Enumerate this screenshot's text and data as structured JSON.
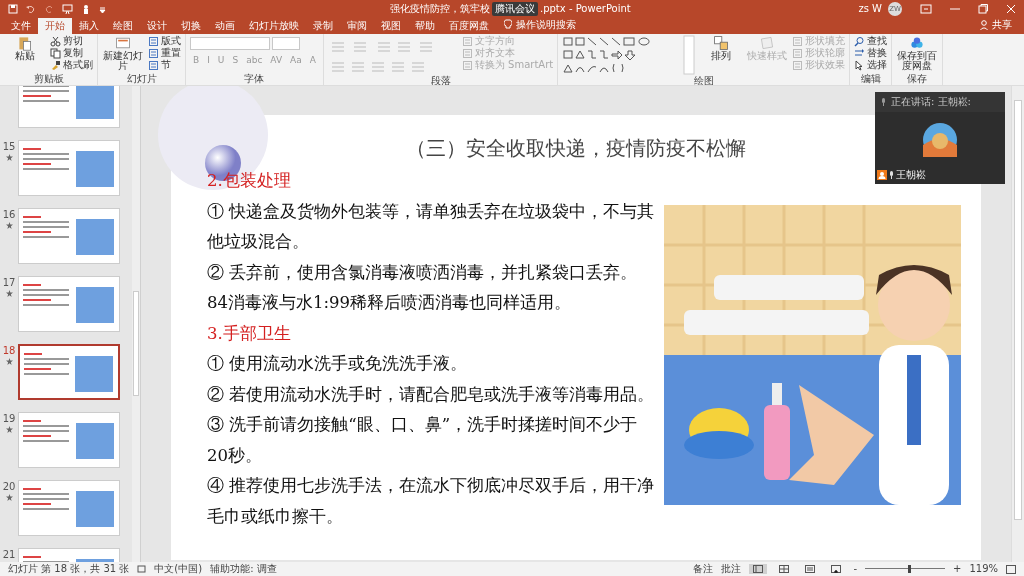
{
  "window": {
    "title": "强化疫情防控，筑牢校",
    "title_suffix": ".pptx  -  PowerPoint",
    "user": "zs W",
    "avatar": "ZW"
  },
  "meeting_badge": "腾讯会议",
  "tabs": [
    {
      "label": "文件",
      "selected": false
    },
    {
      "label": "开始",
      "selected": true
    },
    {
      "label": "插入",
      "selected": false
    },
    {
      "label": "绘图",
      "selected": false
    },
    {
      "label": "设计",
      "selected": false
    },
    {
      "label": "切换",
      "selected": false
    },
    {
      "label": "动画",
      "selected": false
    },
    {
      "label": "幻灯片放映",
      "selected": false
    },
    {
      "label": "录制",
      "selected": false
    },
    {
      "label": "审阅",
      "selected": false
    },
    {
      "label": "视图",
      "selected": false
    },
    {
      "label": "帮助",
      "selected": false
    },
    {
      "label": "百度网盘",
      "selected": false
    }
  ],
  "tell_me": "操作说明搜索",
  "share": "共享",
  "ribbon_groups": [
    {
      "label": "剪贴板",
      "columns": [
        [
          {
            "kind": "large",
            "label": "粘贴",
            "disabled": false
          }
        ],
        [
          {
            "kind": "small",
            "label": "剪切",
            "disabled": false
          },
          {
            "kind": "small",
            "label": "复制",
            "disabled": false
          },
          {
            "kind": "small",
            "label": "格式刷",
            "disabled": false
          }
        ]
      ]
    },
    {
      "label": "幻灯片",
      "columns": [
        [
          {
            "kind": "large",
            "label": "新建幻灯片",
            "disabled": false
          }
        ],
        [
          {
            "kind": "small",
            "label": "版式",
            "disabled": false
          },
          {
            "kind": "small",
            "label": "重置",
            "disabled": false
          },
          {
            "kind": "small",
            "label": "节",
            "disabled": false
          }
        ]
      ]
    },
    {
      "label": "字体",
      "columns": [
        [
          {
            "kind": "font",
            "glyphs": [
              "B",
              "I",
              "U",
              "S",
              "abc",
              "AV",
              "Aa",
              "A"
            ]
          }
        ]
      ]
    },
    {
      "label": "段落",
      "columns": [
        [
          {
            "kind": "para"
          }
        ],
        [
          {
            "kind": "small",
            "label": "文字方向",
            "disabled": true
          },
          {
            "kind": "small",
            "label": "对齐文本",
            "disabled": true
          },
          {
            "kind": "small",
            "label": "转换为 SmartArt",
            "disabled": true
          }
        ]
      ]
    },
    {
      "label": "绘图",
      "columns": [
        [
          {
            "kind": "shapes"
          }
        ],
        [
          {
            "kind": "large",
            "label": "排列",
            "disabled": false
          }
        ],
        [
          {
            "kind": "large",
            "label": "快速样式",
            "disabled": true
          }
        ],
        [
          {
            "kind": "small",
            "label": "形状填充",
            "disabled": true
          },
          {
            "kind": "small",
            "label": "形状轮廓",
            "disabled": true
          },
          {
            "kind": "small",
            "label": "形状效果",
            "disabled": true
          }
        ]
      ]
    },
    {
      "label": "编辑",
      "columns": [
        [
          {
            "kind": "small",
            "label": "查找",
            "disabled": false
          },
          {
            "kind": "small",
            "label": "替换",
            "disabled": false
          },
          {
            "kind": "small",
            "label": "选择",
            "disabled": false
          }
        ]
      ]
    },
    {
      "label": "保存",
      "columns": [
        [
          {
            "kind": "large",
            "label": "保存到百度网盘",
            "disabled": false
          }
        ]
      ]
    }
  ],
  "thumbnails": [
    {
      "selected": false
    },
    {
      "number": "15",
      "has_animation": true,
      "selected": false
    },
    {
      "number": "16",
      "has_animation": true,
      "selected": false
    },
    {
      "number": "17",
      "has_animation": true,
      "selected": false
    },
    {
      "number": "18",
      "has_animation": true,
      "selected": true
    },
    {
      "number": "19",
      "has_animation": true,
      "selected": false
    },
    {
      "number": "20",
      "has_animation": true,
      "selected": false
    },
    {
      "number": "21",
      "selected": false
    }
  ],
  "slide": {
    "title": "（三）安全收取快递，疫情防疫不松懈",
    "body": [
      {
        "kind": "heading",
        "text": "2.包装处理"
      },
      {
        "kind": "paragraph",
        "text": "① 快递盒及货物外包装等，请单独丢弃在垃圾袋中，不与其他垃圾混合。"
      },
      {
        "kind": "paragraph",
        "text": "② 丢弃前，使用含氯消毒液喷洒消毒，并扎紧袋口丢弃。"
      },
      {
        "kind": "paragraph",
        "text": "84消毒液与水1:99稀释后喷洒消毒也同样适用。"
      },
      {
        "kind": "heading",
        "text": "3.手部卫生"
      },
      {
        "kind": "paragraph",
        "text": "① 使用流动水洗手或免洗洗手液。"
      },
      {
        "kind": "paragraph",
        "text": "② 若使用流动水洗手时，请配合肥皂或洗手液等消毒用品。"
      },
      {
        "kind": "paragraph",
        "text": "③ 洗手前请勿接触“眼、口、鼻”，洗手时揉搓时间不少于20秒。"
      },
      {
        "kind": "paragraph",
        "text": "④ 推荐使用七步洗手法，在流水下彻底冲尽双手后，用干净毛巾或纸巾擦干。"
      }
    ]
  },
  "meeting": {
    "speaking": "正在讲话: 王朝崧:",
    "name": "王朝崧"
  },
  "status_bar": {
    "slide_info": "幻灯片 第 18 张，共 31 张",
    "language": "中文(中国)",
    "accessibility": "辅助功能: 调查",
    "notes": "备注",
    "comments": "批注",
    "views": [
      {
        "selected": true
      },
      {
        "selected": false
      },
      {
        "selected": false
      },
      {
        "selected": false
      }
    ],
    "zoom_out": "-",
    "zoom_in": "+",
    "zoom": {
      "level": 0.55,
      "reading": "119%"
    }
  }
}
